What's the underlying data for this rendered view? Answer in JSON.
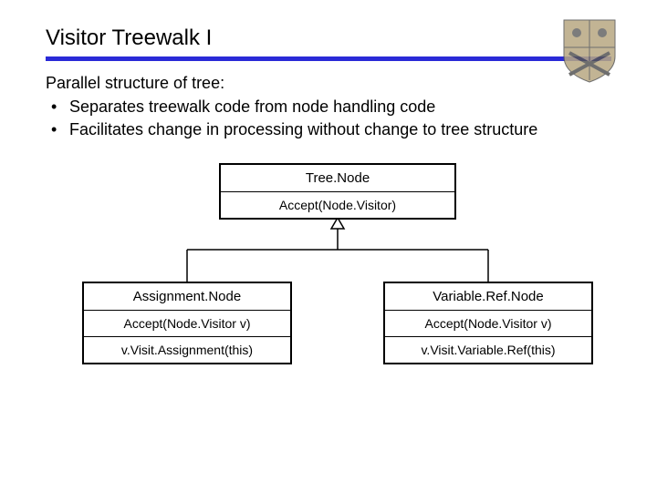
{
  "title": "Visitor Treewalk I",
  "intro": "Parallel structure of tree:",
  "bullets": [
    "Separates treewalk code from node handling code",
    "Facilitates change in processing without change to tree structure"
  ],
  "diagram": {
    "parent": {
      "name": "Tree.Node",
      "method": "Accept(Node.Visitor)"
    },
    "left_child": {
      "name": "Assignment.Node",
      "method": "Accept(Node.Visitor v)",
      "body": "v.Visit.Assignment(this)"
    },
    "right_child": {
      "name": "Variable.Ref.Node",
      "method": "Accept(Node.Visitor v)",
      "body": "v.Visit.Variable.Ref(this)"
    }
  },
  "logo_alt": "shield-crest"
}
